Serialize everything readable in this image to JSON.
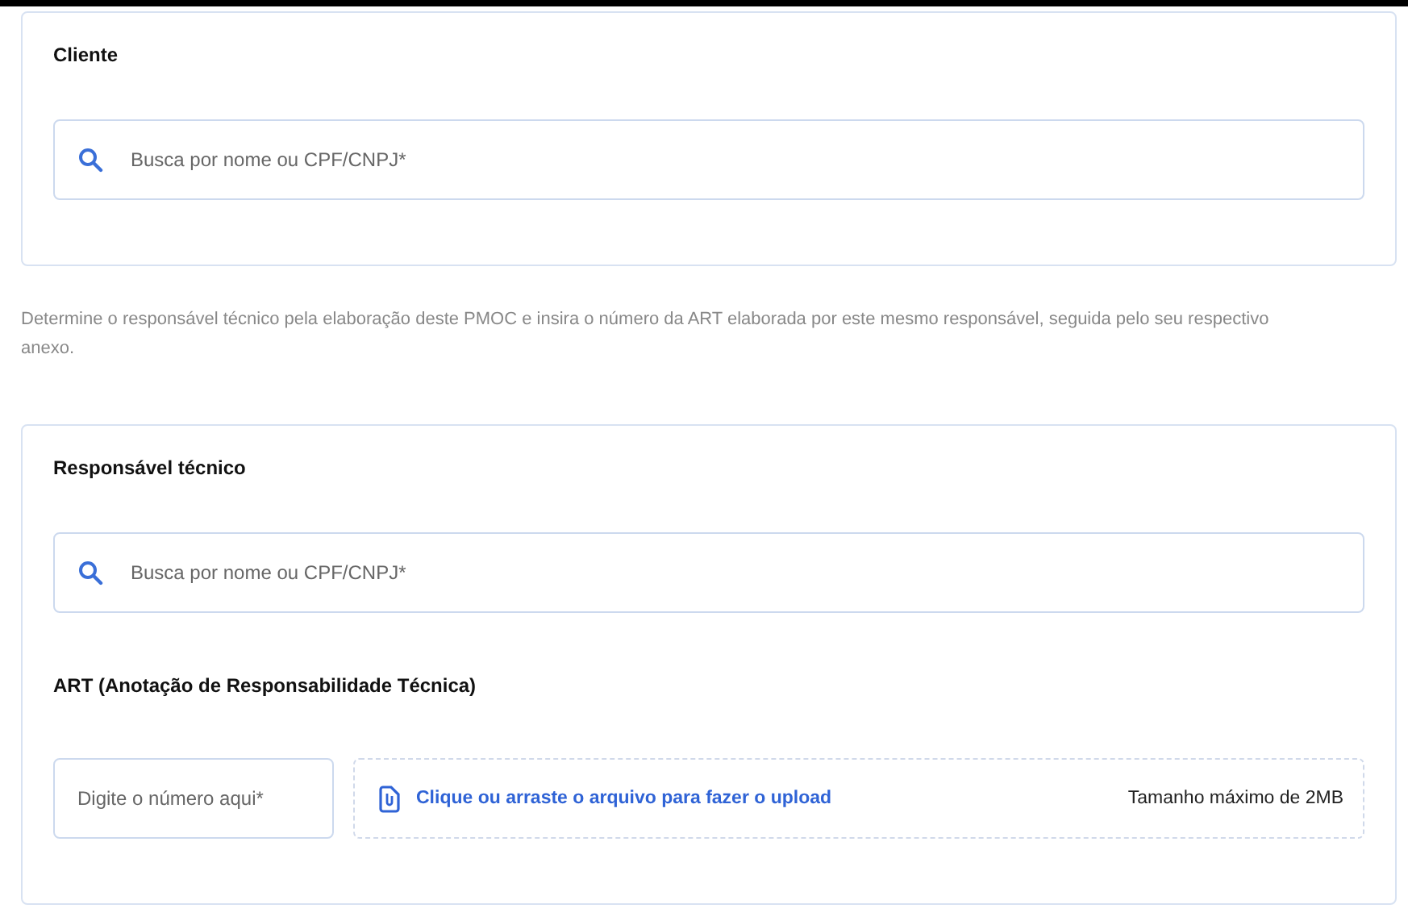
{
  "client_card": {
    "title": "Cliente",
    "search": {
      "placeholder": "Busca por nome ou CPF/CNPJ*"
    }
  },
  "instructions": "Determine o responsável técnico pela elaboração deste PMOC e insira o número da ART elaborada por este mesmo responsável, seguida pelo seu respectivo anexo.",
  "technician_card": {
    "title": "Responsável técnico",
    "search": {
      "placeholder": "Busca por nome ou CPF/CNPJ*"
    },
    "art_title": "ART (Anotação de Responsabilidade Técnica)",
    "art_number": {
      "placeholder": "Digite o número aqui*"
    },
    "upload": {
      "label": "Clique ou arraste o arquivo para fazer o upload",
      "limit": "Tamanho máximo de 2MB"
    }
  }
}
